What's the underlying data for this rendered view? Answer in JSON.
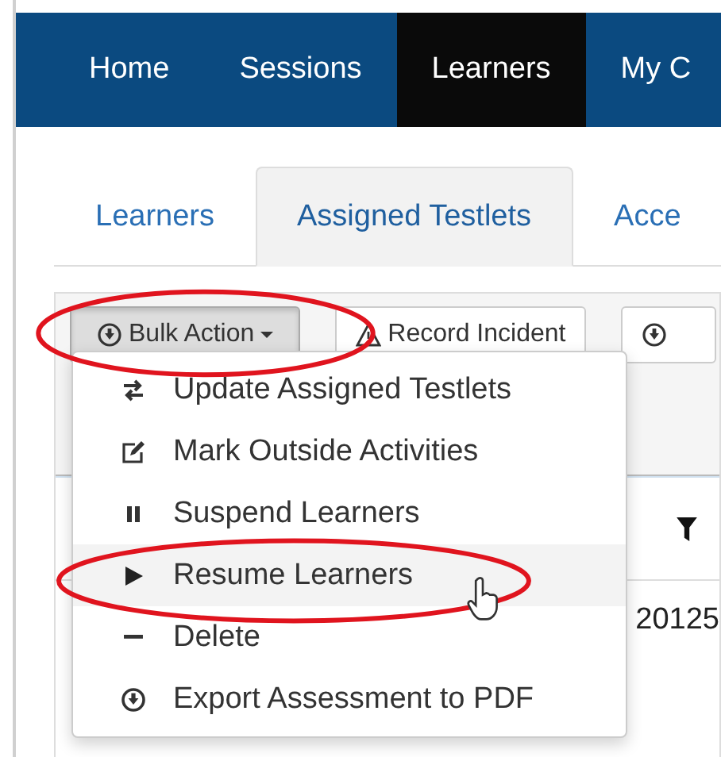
{
  "nav": [
    {
      "label": "Home",
      "selected": false
    },
    {
      "label": "Sessions",
      "selected": false
    },
    {
      "label": "Learners",
      "selected": true
    },
    {
      "label": "My C",
      "selected": false
    }
  ],
  "tabs": [
    {
      "label": "Learners",
      "selected": false
    },
    {
      "label": "Assigned Testlets",
      "selected": true
    },
    {
      "label": "Acce",
      "selected": false
    }
  ],
  "toolbar": {
    "bulk_action": {
      "label": "Bulk Action",
      "expanded": true
    },
    "record_incident": {
      "label": "Record Incident"
    }
  },
  "menu": [
    {
      "kind": "swap",
      "label": "Update Assigned Testlets",
      "highlighted": false
    },
    {
      "kind": "edit",
      "label": "Mark Outside Activities",
      "highlighted": false
    },
    {
      "kind": "pause",
      "label": "Suspend Learners",
      "highlighted": false
    },
    {
      "kind": "play",
      "label": "Resume Learners",
      "highlighted": true
    },
    {
      "kind": "minus",
      "label": "Delete",
      "highlighted": false
    },
    {
      "kind": "download",
      "label": "Export Assessment to PDF",
      "highlighted": false
    }
  ],
  "table": {
    "cell": "20125"
  }
}
